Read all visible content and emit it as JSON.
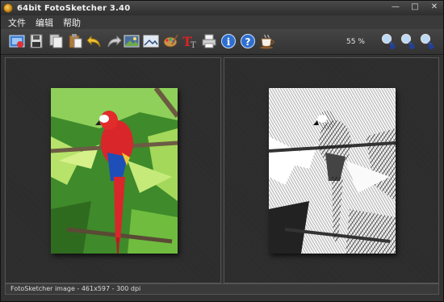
{
  "window": {
    "title": "64bit FotoSketcher 3.40"
  },
  "menu": [
    "文件",
    "编辑",
    "帮助"
  ],
  "toolbar": {
    "zoom": "55 %",
    "buttons": [
      "open-image-icon",
      "save-icon",
      "copy-icon",
      "paste-icon",
      "undo-icon",
      "redo-icon",
      "original-image-icon",
      "drawing-icon",
      "palette-icon",
      "add-text-icon",
      "print-icon",
      "info-icon",
      "help-icon",
      "coffee-icon"
    ],
    "zoom_buttons": [
      "zoom-in-icon",
      "zoom-out-icon",
      "zoom-fit-icon"
    ]
  },
  "status": {
    "text": "FotoSketcher image - 461x597 - 300 dpi"
  },
  "colors": {
    "background": "#333333",
    "accent": "#d9262a"
  }
}
